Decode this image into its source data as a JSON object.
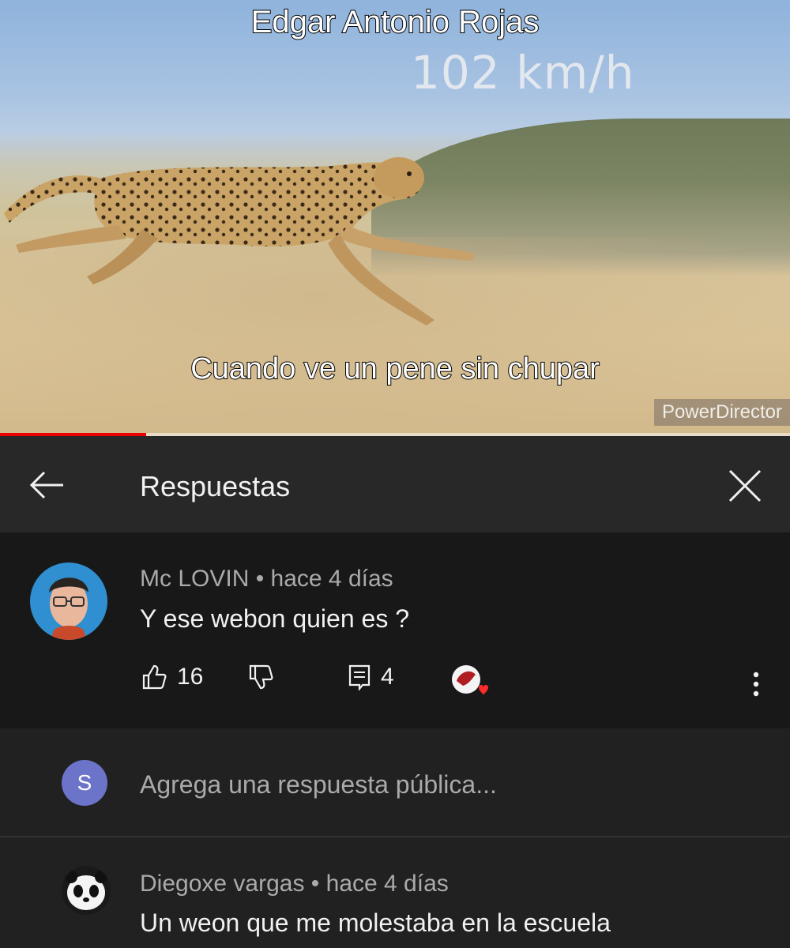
{
  "video": {
    "overlay_title": "Edgar Antonio Rojas",
    "speed_text": "102 km/h",
    "caption": "Cuando ve un pene sin chupar",
    "watermark": "PowerDirector",
    "progress": 0.185,
    "progress_color": "#ee0000"
  },
  "header": {
    "title": "Respuestas",
    "back_icon": "back-arrow-icon",
    "close_icon": "close-icon"
  },
  "comment": {
    "author": "Mc LOVIN",
    "time": "hace 4 días",
    "text": "Y ese webon quien es ?",
    "likes": "16",
    "replies": "4"
  },
  "reply_input": {
    "avatar_letter": "S",
    "placeholder": "Agrega una respuesta pública..."
  },
  "replies": [
    {
      "author": "Diegoxe vargas",
      "time": "hace 4 días",
      "text": "Un weon que me molestaba en la escuela"
    }
  ],
  "colors": {
    "background": "#212121",
    "comment_background": "#181818",
    "secondary_text": "#aaaaaa",
    "avatar_s": "#6b74c9"
  }
}
